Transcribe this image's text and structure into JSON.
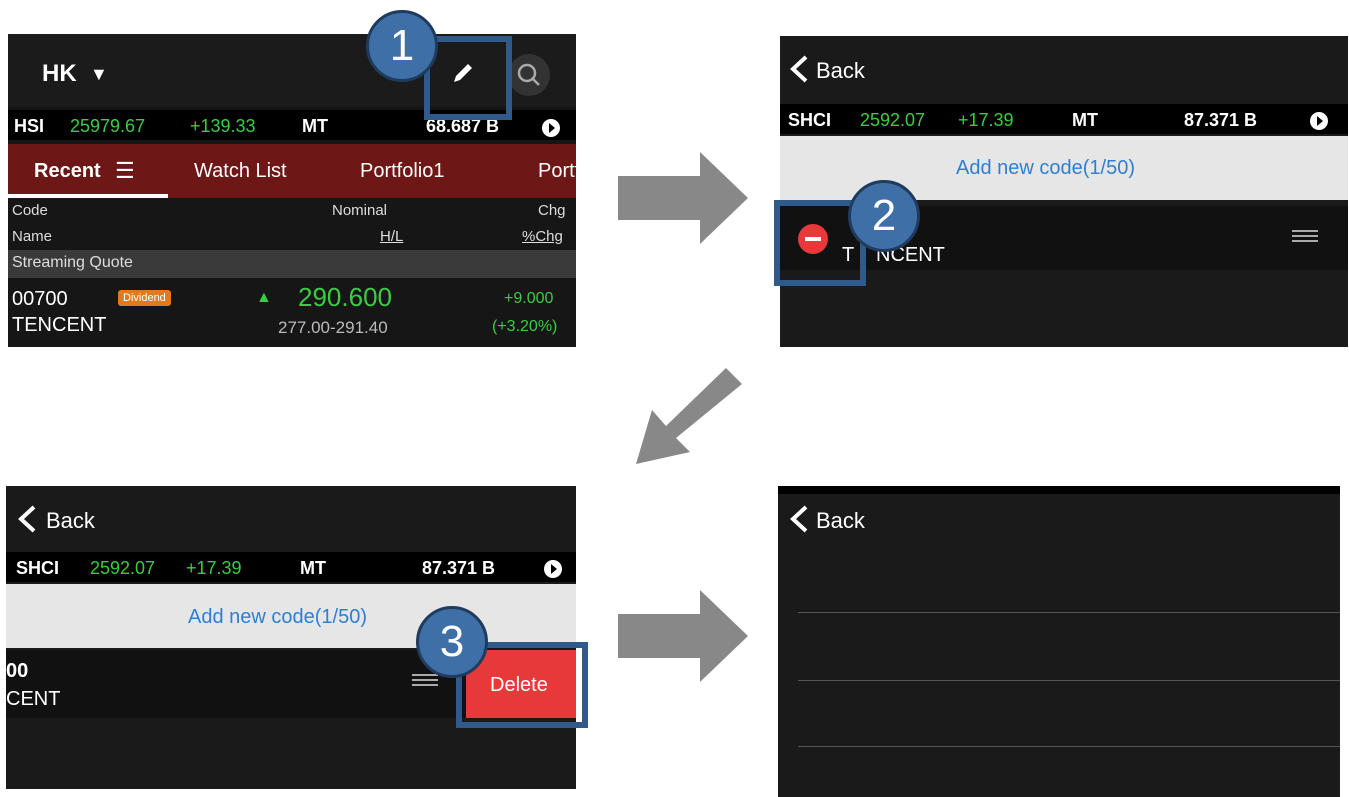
{
  "panel1": {
    "market": "HK",
    "market_caret": "▼",
    "index_bar": {
      "name": "HSI",
      "value": "25979.67",
      "change": "+139.33",
      "mt_label": "MT",
      "mt_value": "68.687 B"
    },
    "tabs": [
      "Recent",
      "Watch List",
      "Portfolio1",
      "Portf"
    ],
    "list_icon": "☰",
    "headers": {
      "code": "Code",
      "name": "Name",
      "nominal": "Nominal",
      "hl": "H/L",
      "chg": "Chg",
      "pchg": "%Chg"
    },
    "section": "Streaming Quote",
    "row": {
      "code": "00700",
      "tag": "Dividend",
      "up_icon": "▲",
      "price": "290.600",
      "chg": "+9.000",
      "name": "TENCENT",
      "range": "277.00-291.40",
      "pchg": "(+3.20%)"
    },
    "icons": [
      "edit-icon",
      "search-icon",
      "play-circle-icon"
    ]
  },
  "panel2": {
    "back": "Back",
    "index_bar": {
      "name": "SHCI",
      "value": "2592.07",
      "change": "+17.39",
      "mt_label": "MT",
      "mt_value": "87.371 B"
    },
    "add_code": "Add new code(1/50)",
    "row_name": "T",
    "row_name_rest": "NCENT"
  },
  "panel3": {
    "back": "Back",
    "index_bar": {
      "name": "SHCI",
      "value": "2592.07",
      "change": "+17.39",
      "mt_label": "MT",
      "mt_value": "87.371 B"
    },
    "add_code": "Add new code(1/50)",
    "row_code": "00",
    "row_name": "CENT",
    "delete_label": "Delete"
  },
  "panel4": {
    "back": "Back"
  },
  "steps": {
    "one": "1",
    "two": "2",
    "three": "3"
  },
  "colors": {
    "green": "#3ccc44",
    "tab_bar": "#6e1717",
    "link_blue": "#2f7fd0",
    "delete_red": "#e8393a",
    "badge_blue": "#3f6fa7",
    "arrow_gray": "#888888"
  }
}
